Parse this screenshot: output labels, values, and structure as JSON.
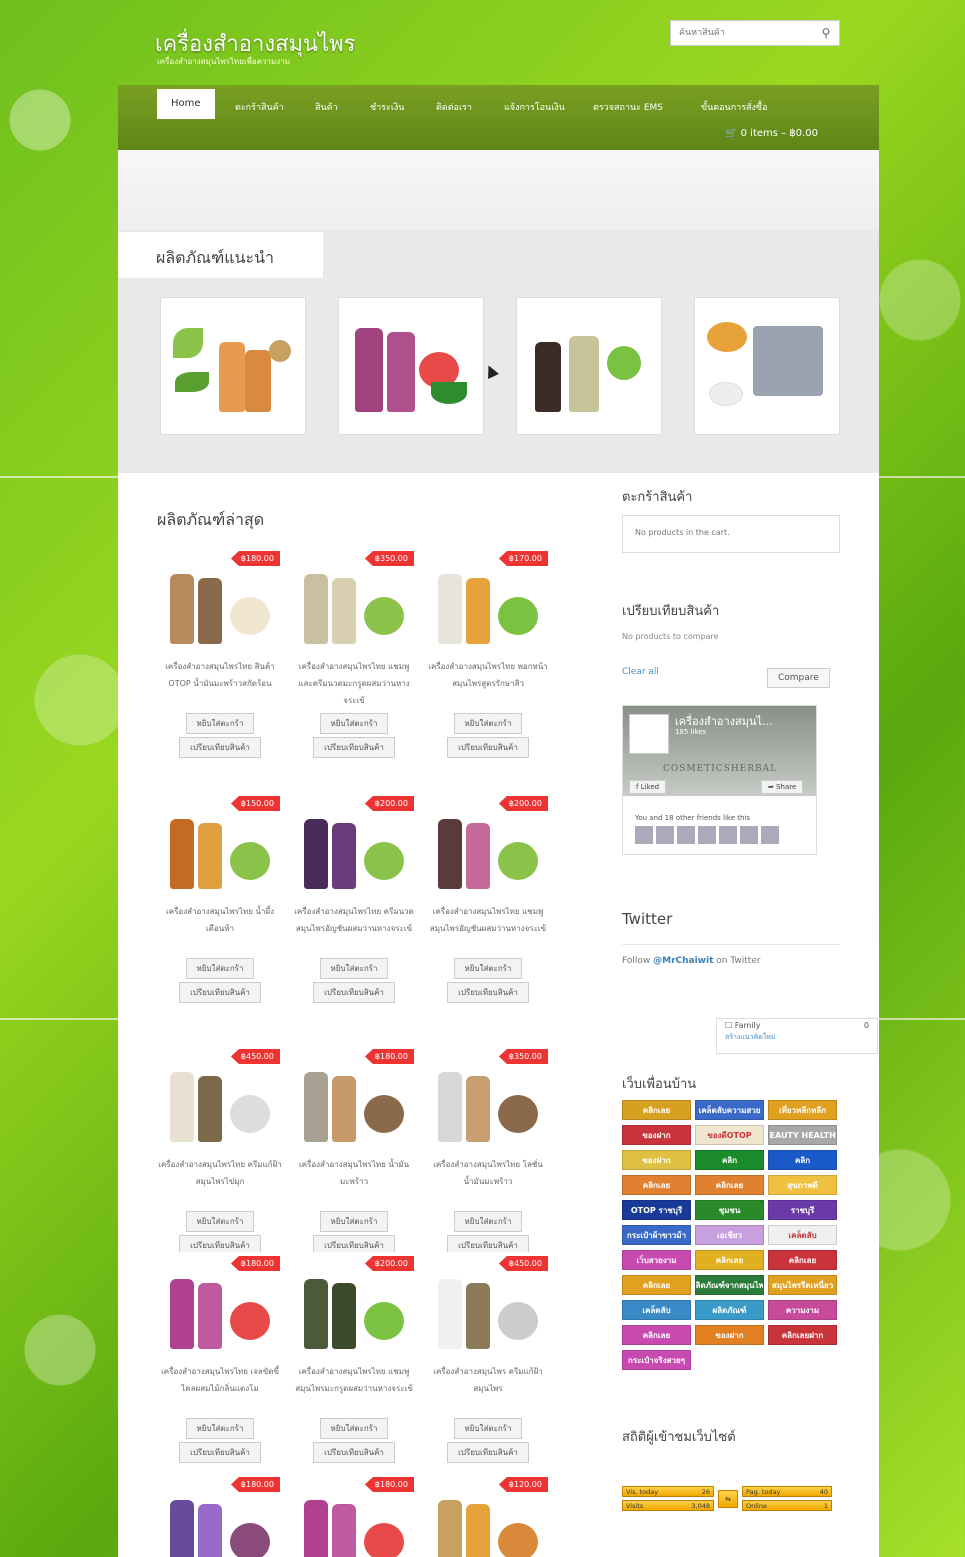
{
  "header": {
    "site_title": "เครื่องสำอางสมุนไพร",
    "tagline": "เครื่องสำอางสมุนไพรไทยเพื่อความงาม",
    "search_placeholder": "ค้นหาสินค้า"
  },
  "nav": {
    "items": [
      "Home",
      "ตะกร้าสินค้า",
      "สินค้า",
      "ชำระเงิน",
      "ติดต่อเรา",
      "แจ้งการโอนเงิน",
      "ตรวจสถานะ EMS",
      "ขั้นตอนการสั่งซื้อ"
    ],
    "cart_summary": "0 items – ฿0.00"
  },
  "featured": {
    "title": "ผลิตภัณฑ์แนะนำ"
  },
  "latest": {
    "title": "ผลิตภัณฑ์ล่าสุด",
    "add_to_cart": "หยิบใส่ตะกร้า",
    "compare": "เปรียบเทียบสินค้า",
    "products": [
      {
        "price": "฿180.00",
        "name": "เครื่องสำอางสมุนไพรไทย สินค้า OTOP น้ำมันมะพร้าวสกัดร้อน"
      },
      {
        "price": "฿350.00",
        "name": "เครื่องสำอางสมุนไพรไทย แชมพูและครีมนวดมะกรูดผสมว่านหางจระเข้"
      },
      {
        "price": "฿170.00",
        "name": "เครื่องสำอางสมุนไพรไทย พอกหน้าสมุนไพรสูตรรักษาสิว"
      },
      {
        "price": "฿150.00",
        "name": "เครื่องสำอางสมุนไพรไทย น้ำผึ้งเดือนห้า"
      },
      {
        "price": "฿200.00",
        "name": "เครื่องสำอางสมุนไพรไทย ครีมนวดสมุนไพรอัญชันผสมว่านหางจระเข้"
      },
      {
        "price": "฿200.00",
        "name": "เครื่องสำอางสมุนไพรไทย แชมพูสมุนไพรอัญชันผสมว่านหางจระเข้"
      },
      {
        "price": "฿450.00",
        "name": "เครื่องสำอางสมุนไพรไทย ครีมแก้ฝ้าสมุนไพรไข่มุก"
      },
      {
        "price": "฿180.00",
        "name": "เครื่องสำอางสมุนไพรไทย น้ำมันมะพร้าว"
      },
      {
        "price": "฿350.00",
        "name": "เครื่องสำอางสมุนไพรไทย โลชั่นน้ำมันมะพร้าว"
      },
      {
        "price": "฿180.00",
        "name": "เครื่องสำอางสมุนไพรไทย เจลขัดขี้ไคลผสมไม้กลิ่นแตงโม"
      },
      {
        "price": "฿200.00",
        "name": "เครื่องสำอางสมุนไพรไทย แชมพูสมุนไพรมะกรูดผสมว่านหางจระเข้"
      },
      {
        "price": "฿450.00",
        "name": "เครื่องสำอางสมุนไพร ครีมแก้ฝ้าสมุนไพร"
      },
      {
        "price": "฿180.00",
        "name": ""
      },
      {
        "price": "฿180.00",
        "name": ""
      },
      {
        "price": "฿120.00",
        "name": ""
      }
    ]
  },
  "sidebar": {
    "cart_title": "ตะกร้าสินค้า",
    "cart_empty": "No products in the cart.",
    "compare_title": "เปรียบเทียบสินค้า",
    "compare_empty": "No products to compare",
    "clear_all": "Clear all",
    "compare_button": "Compare",
    "fb": {
      "page_name": "เครื่องสำอางสมุนไ...",
      "likes": "185 likes",
      "brand": "COSMETICSHERBAL",
      "liked": "Liked",
      "share": "Share",
      "friends": "You and 18 other friends like this"
    },
    "twitter_title": "Twitter",
    "twitter_follow_prefix": "Follow",
    "twitter_handle": "@MrChaiwit",
    "twitter_follow_suffix": "on Twitter",
    "family_label": "Family",
    "family_count": "0",
    "new_window": "สร้างแนวคิดใหม่",
    "friends_title": "เว็บเพื่อนบ้าน",
    "friend_links": [
      "คลิกเลย",
      "เคล็ดลับความสวย",
      "เที่ยวหลีกหลีก",
      "ของฝาก",
      "ของดีOTOP",
      "BEAUTY HEALTHY",
      "ของฝาก",
      "คลิก",
      "คลิก",
      "คลิกเลย",
      "คลิกเลย",
      "สุขภาพดี",
      "OTOP ราชบุรี",
      "ชุมชน",
      "ราชบุรี",
      "กระเป๋าผ้าขาวม้า",
      "เอเชียว",
      "เคล็ดลับ",
      "เว็บสวยงาม",
      "คลิกเลย",
      "คลิกเลย",
      "คลิกเลย",
      "ผลิตภัณฑ์จากสมุนไพร",
      "สมุนไพรรีดเหนี่ยว",
      "เคล็ดลับ",
      "ผลิตภัณฑ์",
      "ความงาม",
      "คลิกเลย",
      "ของฝาก",
      "คลิกเลยฝาก",
      "กระเป๋าจริงสวยๆ"
    ],
    "stats_title": "สถิติผู้เข้าชมเว็บไซต์",
    "stats": {
      "vis_today_label": "Vis. today",
      "vis_today": "26",
      "visits_label": "Visits",
      "visits": "3,048",
      "pag_today_label": "Pag. today",
      "pag_today": "40",
      "online_label": "Online",
      "online": "1"
    }
  },
  "colors": {
    "accent": "#e33333",
    "nav": "#6b9420",
    "link": "#3a7fb8"
  }
}
